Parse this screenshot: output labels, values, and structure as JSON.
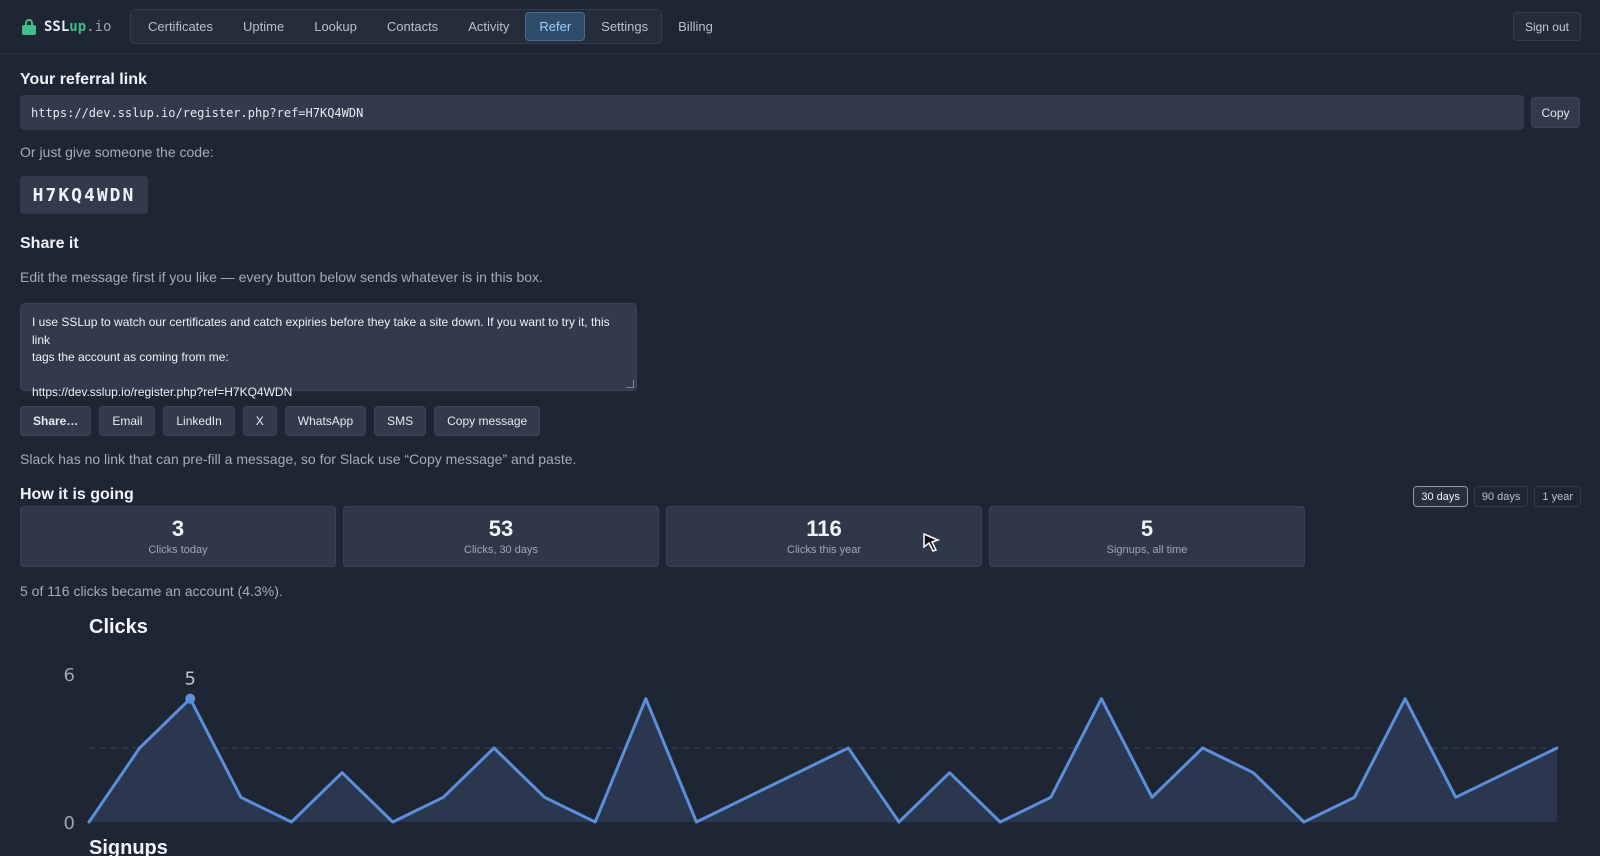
{
  "brand": {
    "name_a": "SSL",
    "name_b": "up",
    "name_c": ".io"
  },
  "nav": [
    "Certificates",
    "Uptime",
    "Lookup",
    "Contacts",
    "Activity",
    "Refer",
    "Settings",
    "Billing"
  ],
  "nav_active": "Refer",
  "signout_label": "Sign out",
  "referral": {
    "heading": "Your referral link",
    "link": "https://dev.sslup.io/register.php?ref=H7KQ4WDN",
    "copy_label": "Copy",
    "code_hint": "Or just give someone the code:",
    "code": "H7KQ4WDN"
  },
  "share": {
    "heading": "Share it",
    "hint": "Edit the message first if you like — every button below sends whatever is in this box.",
    "message_line1": "I use SSLup to watch our certificates and catch expiries before they take a site down. If you want to try it, this link",
    "message_line2": "tags the account as coming from me:",
    "message_line3": "https://dev.sslup.io/register.php?ref=H7KQ4WDN",
    "buttons": [
      "Share…",
      "Email",
      "LinkedIn",
      "X",
      "WhatsApp",
      "SMS",
      "Copy message"
    ],
    "slack_note": "Slack has no link that can pre-fill a message, so for Slack use “Copy message” and paste."
  },
  "stats": {
    "heading": "How it is going",
    "ranges": [
      "30 days",
      "90 days",
      "1 year"
    ],
    "active_range": "30 days",
    "cards": [
      {
        "value": "3",
        "label": "Clicks today"
      },
      {
        "value": "53",
        "label": "Clicks, 30 days"
      },
      {
        "value": "116",
        "label": "Clicks this year"
      },
      {
        "value": "5",
        "label": "Signups, all time"
      }
    ],
    "conversion": "5 of 116 clicks became an account (4.3%)."
  },
  "charts": {
    "clicks_title": "Clicks",
    "signups_title": "Signups"
  },
  "chart_data": {
    "type": "area",
    "title": "Clicks",
    "x": [
      1,
      2,
      3,
      4,
      5,
      6,
      7,
      8,
      9,
      10,
      11,
      12,
      13,
      14,
      15,
      16,
      17,
      18,
      19,
      20,
      21,
      22,
      23,
      24,
      25,
      26,
      27,
      28,
      29,
      30
    ],
    "values": [
      0,
      3,
      5,
      1,
      0,
      2,
      0,
      1,
      3,
      1,
      0,
      5,
      0,
      1,
      2,
      3,
      0,
      2,
      0,
      1,
      5,
      1,
      3,
      2,
      0,
      1,
      5,
      1,
      2,
      3
    ],
    "ylim": [
      0,
      6
    ],
    "y_ticks": [
      "0",
      "6"
    ],
    "peak_label": "5",
    "reference_line": 3,
    "color": "#5b8fd9",
    "fill": "#2b3a52"
  }
}
